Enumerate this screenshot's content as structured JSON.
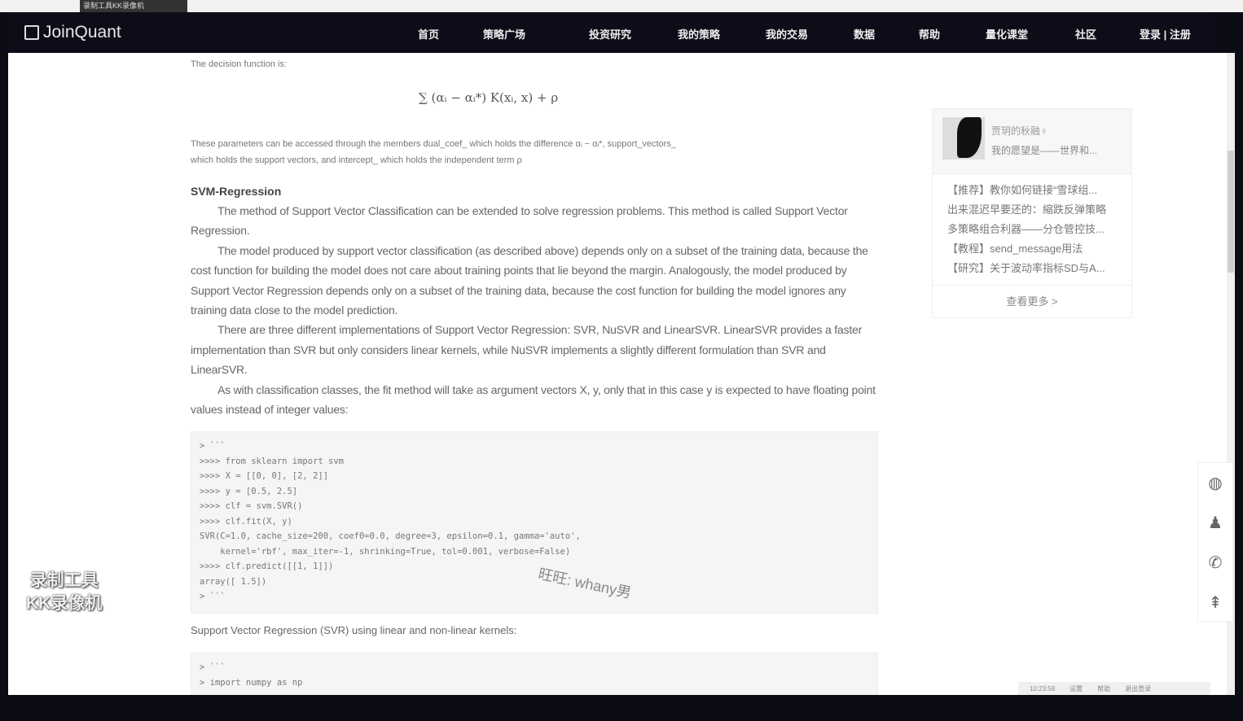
{
  "recorder": {
    "top_title": "录制工具KK录像机",
    "label_line1": "录制工具",
    "label_line2": "KK录像机"
  },
  "nav": {
    "logo": "JoinQuant",
    "items": [
      "首页",
      "策略广场",
      "投资研究",
      "我的策略",
      "我的交易",
      "数据",
      "帮助",
      "量化课堂",
      "社区",
      "登录 | 注册"
    ]
  },
  "article": {
    "decision_intro": "The decision function is:",
    "formula": "∑ (αᵢ − αᵢ*) K(xᵢ, x) + ρ",
    "params_line1": "These parameters can be accessed through the members dual_coef_ which holds the difference αᵢ − αᵢ*, support_vectors_",
    "params_line2": "which holds the support vectors, and intercept_ which holds the independent term ρ",
    "heading": "SVM-Regression",
    "paragraphs": [
      "The method of Support Vector Classification can be extended to solve regression problems. This method is called Support Vector Regression.",
      "The model produced by support vector classification (as described above) depends only on a subset of the training data, because the cost function for building the model does not care about training points that lie beyond the margin. Analogously, the model produced by Support Vector Regression depends only on a subset of the training data, because the cost function for building the model ignores any training data close to the model prediction.",
      "There are three different implementations of Support Vector Regression: SVR, NuSVR and LinearSVR. LinearSVR provides a faster implementation than SVR but only considers linear kernels, while NuSVR implements a slightly different formulation than SVR and LinearSVR.",
      "As with classification classes, the fit method will take as argument vectors X, y, only that in this case y is expected to have floating point values instead of integer values:"
    ],
    "code1": "> ```\n>>>> from sklearn import svm\n>>>> X = [[0, 0], [2, 2]]\n>>>> y = [0.5, 2.5]\n>>>> clf = svm.SVR()\n>>>> clf.fit(X, y)\nSVR(C=1.0, cache_size=200, coef0=0.0, degree=3, epsilon=0.1, gamma='auto',\n    kernel='rbf', max_iter=-1, shrinking=True, tol=0.001, verbose=False)\n>>>> clf.predict([[1, 1]])\narray([ 1.5])\n> ```",
    "caption": "Support Vector Regression (SVR) using linear and non-linear kernels:",
    "code2": "> ```\n> import numpy as np",
    "watermark": "旺旺: whany男"
  },
  "sidebar": {
    "user_name": "贾玥的秋融♀",
    "user_sig": "我的愿望是——世界和...",
    "posts": [
      "【推荐】教你如何链接“雪球组...",
      "出来混迟早要还的：縮跌反弹策略",
      "多策略组合利器——分仓管控技...",
      "【教程】send_message用法",
      "【研究】关于波动率指标SD与A..."
    ],
    "more": "查看更多 >"
  },
  "bottombar": [
    "10:23:58",
    "设置",
    "帮助",
    "退出登录"
  ]
}
